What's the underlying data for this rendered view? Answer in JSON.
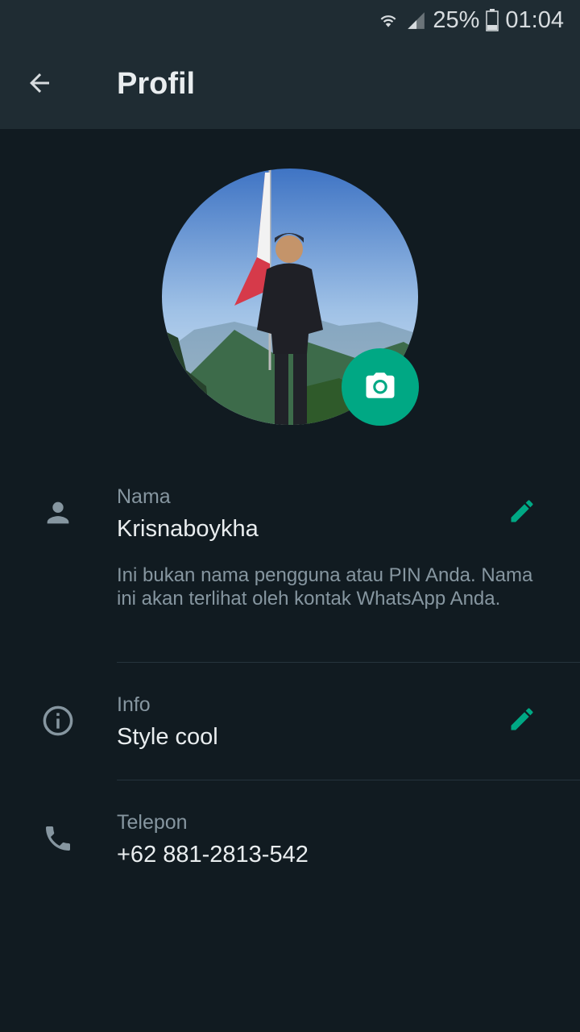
{
  "status_bar": {
    "battery": "25%",
    "time": "01:04",
    "icons": [
      "wifi-icon",
      "signal-icon",
      "battery-icon"
    ]
  },
  "app_bar": {
    "title": "Profil",
    "back_icon": "arrow-back-icon"
  },
  "avatar": {
    "camera_icon": "camera-icon"
  },
  "name_row": {
    "icon": "person-icon",
    "label": "Nama",
    "value": "Krisnaboykha",
    "hint": "Ini bukan nama pengguna atau PIN Anda. Nama ini akan terlihat oleh kontak WhatsApp Anda.",
    "edit_icon": "pencil-icon"
  },
  "info_row": {
    "icon": "info-icon",
    "label": "Info",
    "value": "Style cool",
    "edit_icon": "pencil-icon"
  },
  "phone_row": {
    "icon": "phone-icon",
    "label": "Telepon",
    "value": "+62 881-2813-542"
  },
  "colors": {
    "background": "#111b21",
    "app_bar": "#1f2c33",
    "accent": "#00a884",
    "secondary_text": "#8696a0",
    "primary_text": "#e9edef"
  }
}
